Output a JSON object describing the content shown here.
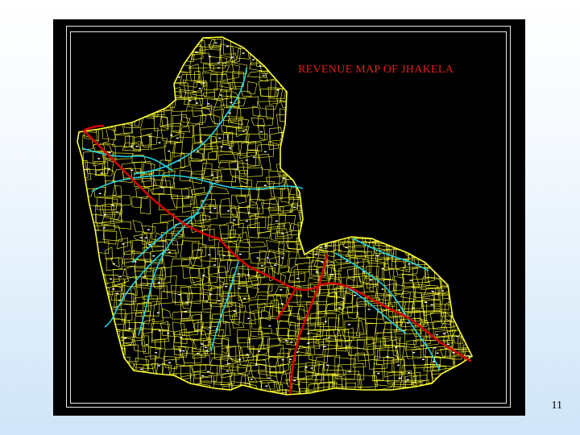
{
  "map": {
    "title": "REVENUE MAP OF JHAKELA",
    "colors": {
      "background": "#000000",
      "plot_boundaries": "#ffff33",
      "streams": "#22d6e6",
      "roads": "#d40000",
      "title_text": "#e0201a",
      "border": "#e8e8e8"
    }
  },
  "slide": {
    "number": "11"
  }
}
